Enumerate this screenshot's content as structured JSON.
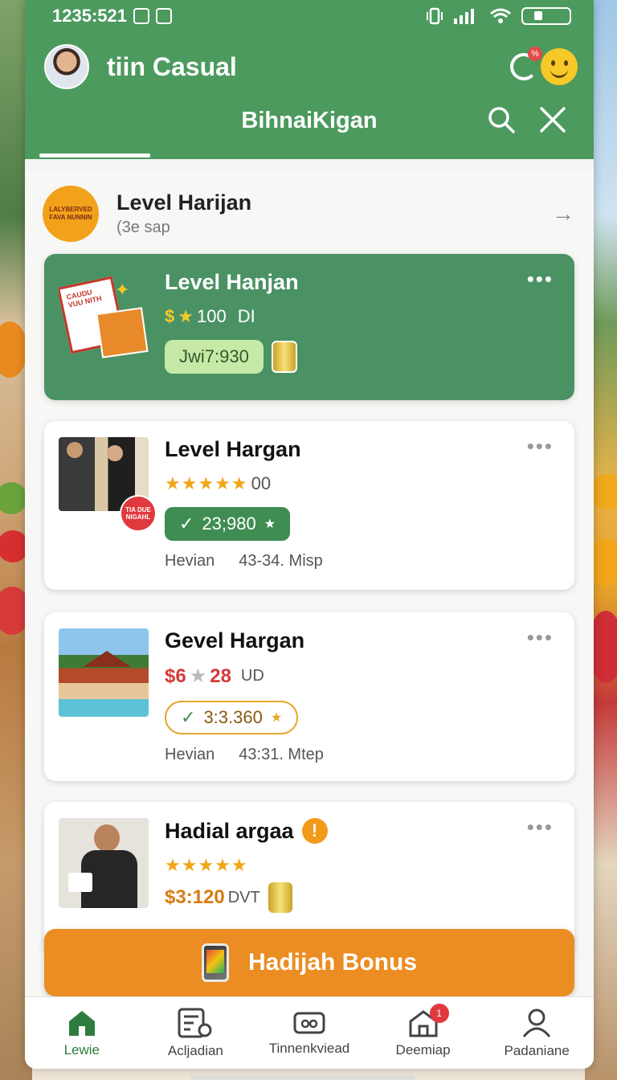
{
  "status_bar": {
    "time": "1235:521"
  },
  "profile": {
    "name": "tiin Casual",
    "notification_badge": "%"
  },
  "nav": {
    "title": "BihnaiKigan"
  },
  "section": {
    "title": "Level Harijan",
    "subtitle": "(3e sap",
    "logo_text": "LALYBERVED FAVA NUNNIN"
  },
  "cards": [
    {
      "title": "Level Hanjan",
      "price_prefix": "$",
      "price_value": "100",
      "price_unit": "DI",
      "pill_text": "Jwi7:930",
      "thumb_text": "CAUDU VUU NITH"
    },
    {
      "title": "Level Hargan",
      "rating_text": "00",
      "pill_text": "23;980",
      "meta_left": "Hevian",
      "meta_right": "43-34. Misp",
      "sticker_text": "TIA DUE NIGAHL"
    },
    {
      "title": "Gevel Hargan",
      "price_a": "$6",
      "price_b": "28",
      "price_unit": "UD",
      "pill_text": "3:3.360",
      "meta_left": "Hevian",
      "meta_right": "43:31. Mtep"
    },
    {
      "title": "Hadial argaa",
      "alert": "!",
      "price": "$3:120",
      "price_unit": "DVT"
    }
  ],
  "bonus_button": {
    "label": "Hadijah Bonus"
  },
  "tabs": [
    {
      "label": "Lewie",
      "icon": "home-icon"
    },
    {
      "label": "Acljadian",
      "icon": "list-icon"
    },
    {
      "label": "Tinnenkviead",
      "icon": "ticket-icon"
    },
    {
      "label": "Deemiap",
      "icon": "shop-icon",
      "badge": "1"
    },
    {
      "label": "Padaniane",
      "icon": "profile-icon"
    }
  ],
  "colors": {
    "brand_green": "#4c9a5e",
    "accent_orange": "#eb8d22",
    "star": "#f2a516",
    "alert_red": "#e0393e"
  }
}
